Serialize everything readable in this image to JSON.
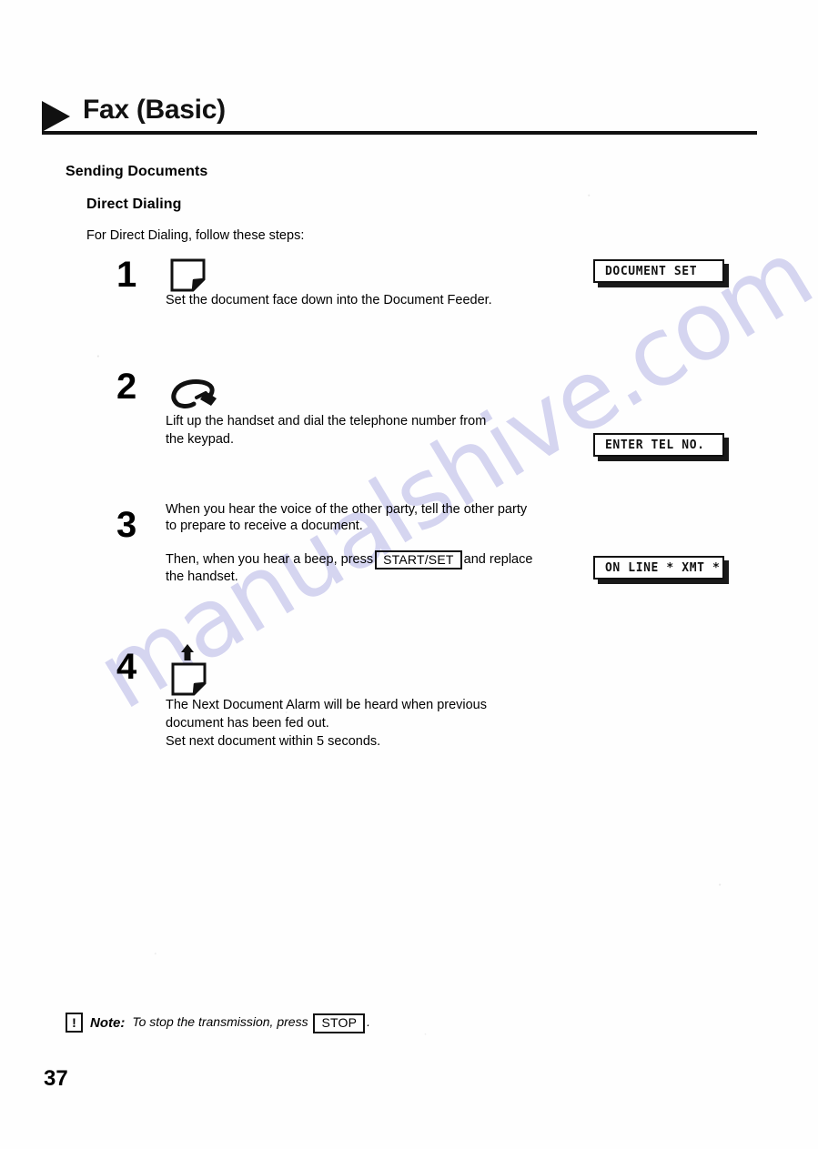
{
  "chapter": {
    "title": "Fax (Basic)",
    "bullet_icon": "triangle-right-icon"
  },
  "section": {
    "title": "Sending Documents",
    "subsection": "Direct Dialing",
    "intro": "For Direct Dialing, follow these steps:"
  },
  "steps": [
    {
      "number": "1",
      "icon": "document-icon",
      "lines": [
        "Set the document face down into the Document Feeder."
      ],
      "display": "DOCUMENT SET"
    },
    {
      "number": "2",
      "icon": "telephone-handset-icon",
      "lines": [
        "Lift up the handset and dial the telephone number from",
        "the keypad."
      ],
      "display": "ENTER TEL NO."
    },
    {
      "number": "3",
      "icon": "",
      "para1": "When you hear the voice of the other party, tell the other party to prepare to receive a document.",
      "para2_before": "Then, when you hear a beep, press",
      "para2_key": "START/SET",
      "para2_after": "and replace the handset.",
      "display": "ON LINE * XMT *"
    },
    {
      "number": "4",
      "icon": "document-eject-icon",
      "lines": [
        "The Next Document Alarm will be heard when previous",
        "document has been fed out.",
        "Set next document within 5 seconds."
      ],
      "display": ""
    }
  ],
  "note": {
    "icon": "exclamation-box-icon",
    "icon_glyph": "!",
    "label": "Note:",
    "text_before": "To stop the transmission, press",
    "key": "STOP",
    "text_after": "."
  },
  "footer": {
    "page_number": "37"
  },
  "watermark": {
    "text": "manualshive.com",
    "color": "#bdbce8"
  }
}
